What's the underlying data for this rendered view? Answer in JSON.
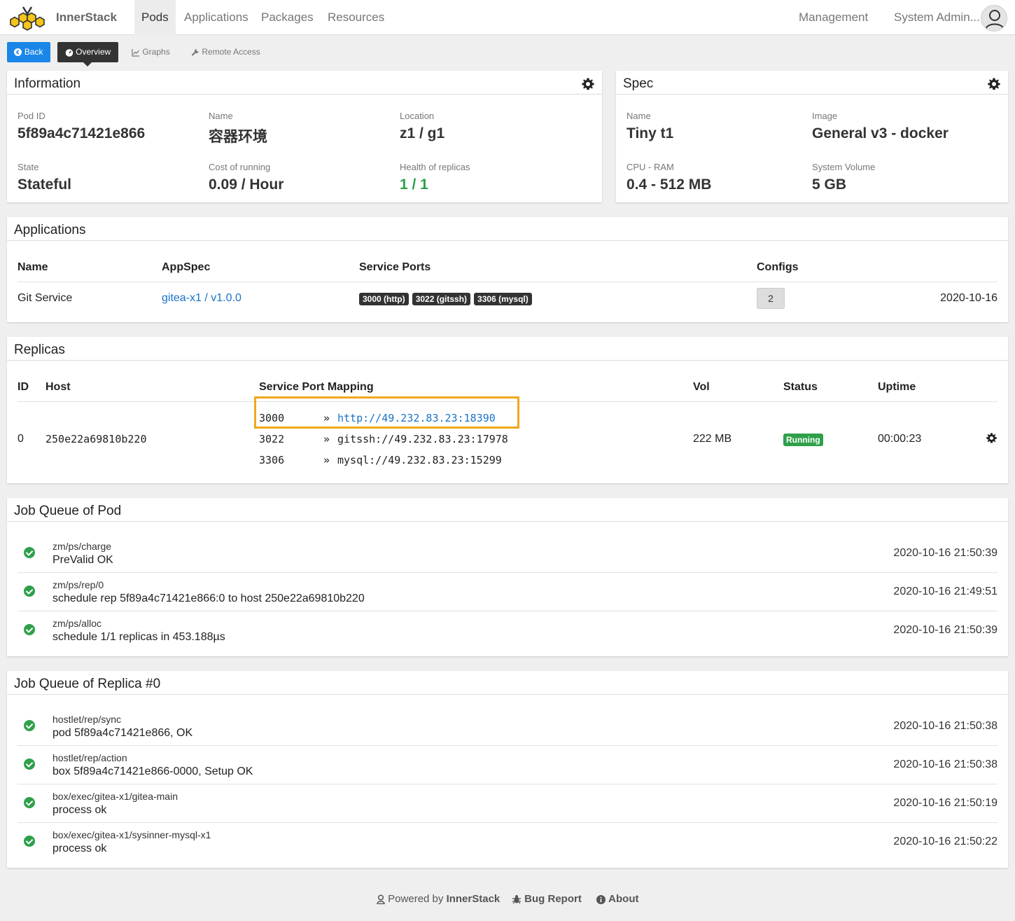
{
  "nav": {
    "brand": "InnerStack",
    "items": [
      "Pods",
      "Applications",
      "Packages",
      "Resources"
    ],
    "management": "Management",
    "user": "System Admin..."
  },
  "toolbar": {
    "back": "Back",
    "overview": "Overview",
    "graphs": "Graphs",
    "remote_access": "Remote Access"
  },
  "information": {
    "title": "Information",
    "fields": [
      {
        "label": "Pod ID",
        "value": "5f89a4c71421e866"
      },
      {
        "label": "Name",
        "value": "容器环境"
      },
      {
        "label": "Location",
        "value": "z1 / g1"
      },
      {
        "label": "State",
        "value": "Stateful"
      },
      {
        "label": "Cost of running",
        "value": "0.09 / Hour"
      },
      {
        "label": "Health of replicas",
        "value": "1 / 1"
      }
    ]
  },
  "spec": {
    "title": "Spec",
    "fields": [
      {
        "label": "Name",
        "value": "Tiny t1"
      },
      {
        "label": "Image",
        "value": "General v3 - docker"
      },
      {
        "label": "CPU - RAM",
        "value": "0.4 - 512 MB"
      },
      {
        "label": "System Volume",
        "value": "5 GB"
      }
    ]
  },
  "applications": {
    "title": "Applications",
    "headers": [
      "Name",
      "AppSpec",
      "Service Ports",
      "Configs"
    ],
    "rows": [
      {
        "name": "Git Service",
        "appspec": "gitea-x1 / v1.0.0",
        "ports": [
          "3000 (http)",
          "3022 (gitssh)",
          "3306 (mysql)"
        ],
        "configs": "2",
        "date": "2020-10-16"
      }
    ]
  },
  "replicas": {
    "title": "Replicas",
    "headers": [
      "ID",
      "Host",
      "Service Port Mapping",
      "Vol",
      "Status",
      "Uptime"
    ],
    "rows": [
      {
        "id": "0",
        "host": "250e22a69810b220",
        "mappings": [
          {
            "port": "3000",
            "arrow": "»",
            "target": "http://49.232.83.23:18390"
          },
          {
            "port": "3022",
            "arrow": "»",
            "target": "gitssh://49.232.83.23:17978"
          },
          {
            "port": "3306",
            "arrow": "»",
            "target": "mysql://49.232.83.23:15299"
          }
        ],
        "vol": "222 MB",
        "status": "Running",
        "uptime": "00:00:23"
      }
    ]
  },
  "pod_jobs": {
    "title": "Job Queue of Pod",
    "items": [
      {
        "name": "zm/ps/charge",
        "message": "PreValid OK",
        "time": "2020-10-16 21:50:39"
      },
      {
        "name": "zm/ps/rep/0",
        "message": "schedule rep 5f89a4c71421e866:0 to host 250e22a69810b220",
        "time": "2020-10-16 21:49:51"
      },
      {
        "name": "zm/ps/alloc",
        "message": "schedule 1/1 replicas in 453.188µs",
        "time": "2020-10-16 21:50:39"
      }
    ]
  },
  "replica_jobs": {
    "title": "Job Queue of Replica #0",
    "items": [
      {
        "name": "hostlet/rep/sync",
        "message": "pod 5f89a4c71421e866, OK",
        "time": "2020-10-16 21:50:38"
      },
      {
        "name": "hostlet/rep/action",
        "message": "box 5f89a4c71421e866-0000, Setup OK",
        "time": "2020-10-16 21:50:38"
      },
      {
        "name": "box/exec/gitea-x1/gitea-main",
        "message": "process ok",
        "time": "2020-10-16 21:50:19"
      },
      {
        "name": "box/exec/gitea-x1/sysinner-mysql-x1",
        "message": "process ok",
        "time": "2020-10-16 21:50:22"
      }
    ]
  },
  "footer": {
    "powered_prefix": "Powered by",
    "powered_brand": "InnerStack",
    "bug_report": "Bug Report",
    "about": "About"
  },
  "colors": {
    "primary": "#1a86e8",
    "success": "#2ea04a",
    "highlight": "#f0a81a",
    "dark": "#333333"
  }
}
